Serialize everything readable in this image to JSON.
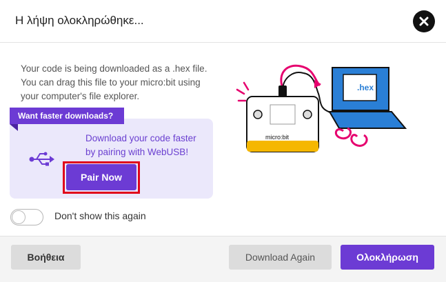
{
  "header": {
    "title": "Η λήψη ολοκληρώθηκε..."
  },
  "body": {
    "description": "Your code is being downloaded as a .hex file. You can drag this file to your micro:bit using your computer's file explorer."
  },
  "webusb_card": {
    "ribbon": "Want faster downloads?",
    "text": "Download your code faster by pairing with WebUSB!",
    "pair_label": "Pair Now"
  },
  "illustration": {
    "file_label": ".hex",
    "board_label": "micro:bit"
  },
  "toggle": {
    "label": "Don't show this again",
    "checked": false
  },
  "footer": {
    "help_label": "Βοήθεια",
    "download_again_label": "Download Again",
    "finish_label": "Ολοκλήρωση"
  },
  "colors": {
    "accent": "#6c3bd4",
    "card_bg": "#ebe8fb",
    "highlight": "#e0001a",
    "laptop": "#2a7fd6",
    "magenta": "#e6006e",
    "board_gold": "#f5b700"
  }
}
